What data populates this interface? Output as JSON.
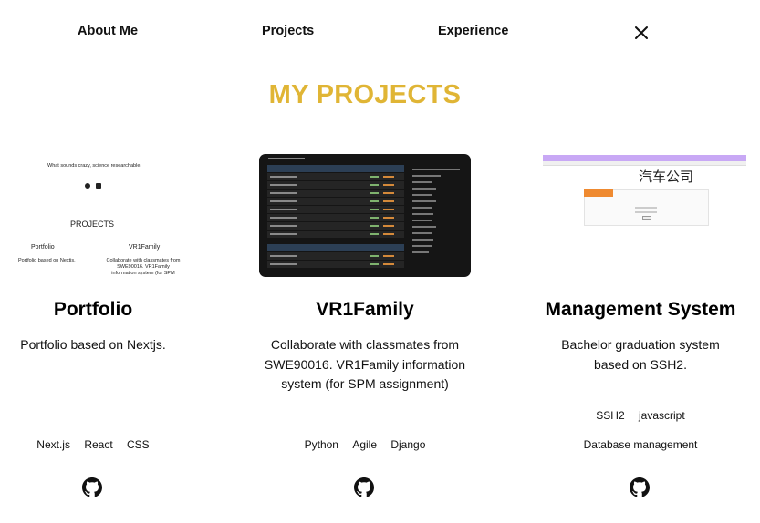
{
  "nav": {
    "about": "About Me",
    "projects": "Projects",
    "experience": "Experience"
  },
  "section": {
    "title": "MY PROJECTS"
  },
  "projects": [
    {
      "title": "Portfolio",
      "description": "Portfolio based on Nextjs.",
      "tags": [
        "Next.js",
        "React",
        "CSS"
      ],
      "thumb": {
        "tagline": "What sounds crazy, science researchable.",
        "heading": "PROJECTS",
        "card1_title": "Portfolio",
        "card1_desc": "Portfolio based on Nextjs.",
        "card2_title": "VR1Family",
        "card2_desc": "Collaborate with classmates from SWE90016. VR1Family information system (for SPM assignment)"
      }
    },
    {
      "title": "VR1Family",
      "description": "Collaborate with classmates from SWE90016. VR1Family information system (for SPM assignment)",
      "tags": [
        "Python",
        "Agile",
        "Django"
      ]
    },
    {
      "title": "Management System",
      "description": "Bachelor graduation system based on SSH2.",
      "tags": [
        "SSH2",
        "javascript"
      ],
      "tags2": [
        "Database management"
      ],
      "thumb": {
        "heading": "汽车公司"
      }
    }
  ],
  "colors": {
    "accent": "#e0b535",
    "text": "#111111"
  },
  "icons": {
    "close": "close-icon",
    "github": "github-icon"
  }
}
